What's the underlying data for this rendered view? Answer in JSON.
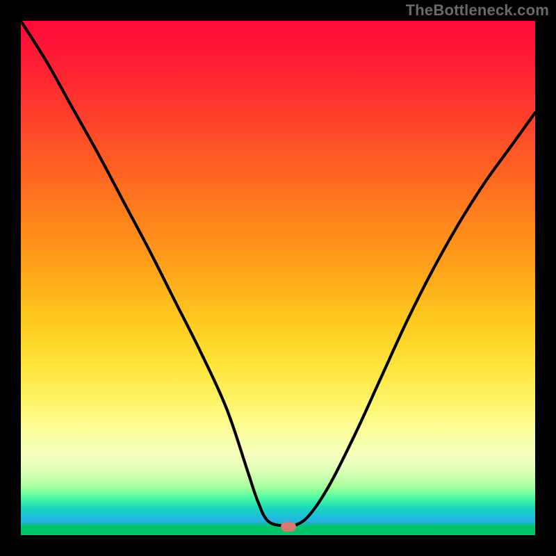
{
  "watermark": "TheBottleneck.com",
  "chart_data": {
    "type": "line",
    "title": "",
    "xlabel": "",
    "ylabel": "",
    "xlim": [
      0,
      100
    ],
    "ylim": [
      0,
      100
    ],
    "grid": false,
    "series": [
      {
        "name": "bottleneck-curve",
        "x": [
          0,
          5,
          10,
          15,
          20,
          25,
          30,
          35,
          40,
          44,
          46,
          48,
          51,
          53,
          56,
          60,
          65,
          70,
          75,
          80,
          85,
          90,
          95,
          100
        ],
        "values": [
          100,
          92,
          83,
          74,
          64.5,
          55,
          45,
          35,
          24,
          12,
          6,
          2,
          1,
          1,
          3,
          9,
          19,
          30,
          41,
          51,
          60,
          68,
          75,
          82
        ]
      }
    ],
    "annotations": [
      {
        "name": "optimal-marker",
        "x": 52,
        "y": 0.8,
        "color": "#d57a70"
      }
    ],
    "background_gradient": {
      "direction": "vertical",
      "stops": [
        {
          "pct": 0,
          "color": "#ff0a3a"
        },
        {
          "pct": 22,
          "color": "#ff4a28"
        },
        {
          "pct": 48,
          "color": "#ffa21a"
        },
        {
          "pct": 67,
          "color": "#ffe43a"
        },
        {
          "pct": 85,
          "color": "#f3ffc0"
        },
        {
          "pct": 92,
          "color": "#6cff9c"
        },
        {
          "pct": 95.2,
          "color": "#1ad0c4"
        },
        {
          "pct": 97.2,
          "color": "#28b2e8"
        },
        {
          "pct": 100,
          "color": "#00c466"
        }
      ]
    }
  }
}
